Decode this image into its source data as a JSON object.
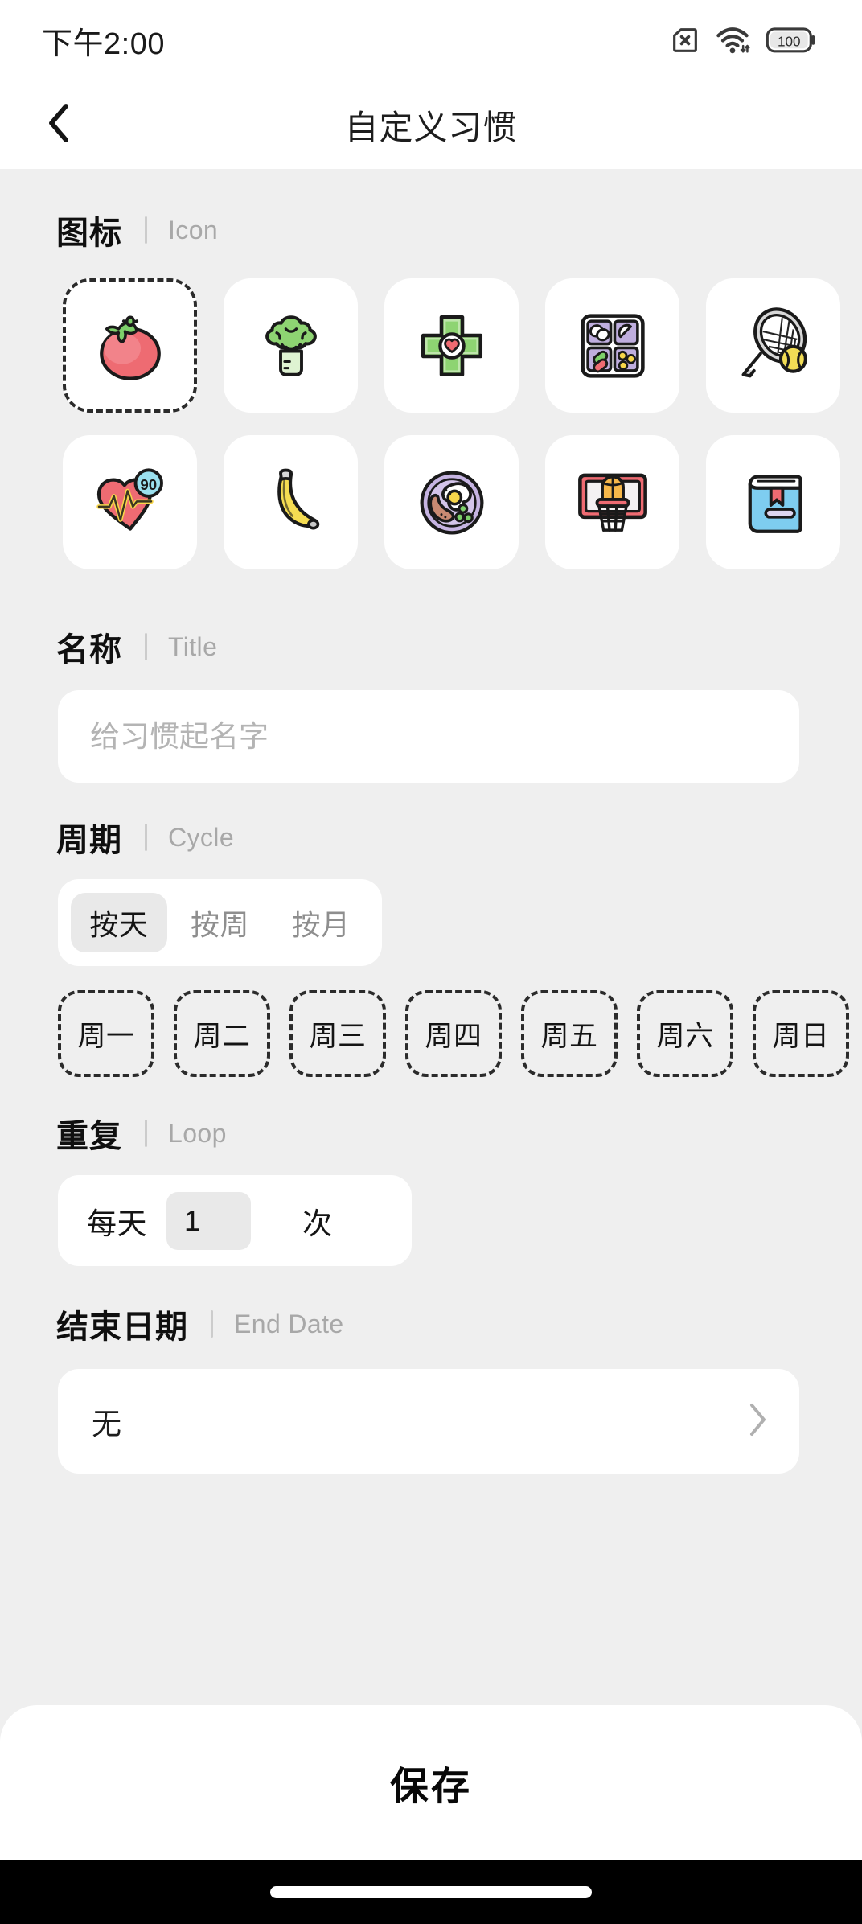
{
  "status_bar": {
    "time": "下午2:00",
    "sim_icon": "sim-card-disabled-icon",
    "wifi_icon": "wifi-icon",
    "battery_icon": "battery-icon",
    "battery_level": "100"
  },
  "nav": {
    "back_icon": "chevron-left-icon",
    "title": "自定义习惯"
  },
  "colors": {
    "page_bg": "#efefef",
    "card_bg": "#ffffff",
    "text_primary": "#141414",
    "text_muted": "#a8a8a8",
    "selected_chip_bg": "#e9e9e9",
    "dashed_border": "#2b2b2b"
  },
  "sections": {
    "icon": {
      "label_cn": "图标",
      "label_en": "Icon",
      "selected_index": 0,
      "rows": [
        [
          {
            "name": "tomato-icon",
            "label": "番茄"
          },
          {
            "name": "broccoli-icon",
            "label": "西兰花"
          },
          {
            "name": "medical-cross-heart-icon",
            "label": "医疗"
          },
          {
            "name": "pill-box-icon",
            "label": "药盒"
          },
          {
            "name": "tennis-racket-icon",
            "label": "网球"
          }
        ],
        [
          {
            "name": "heart-rate-icon",
            "label": "心率",
            "badge": "90"
          },
          {
            "name": "banana-icon",
            "label": "香蕉"
          },
          {
            "name": "breakfast-plate-icon",
            "label": "早餐"
          },
          {
            "name": "basketball-hoop-icon",
            "label": "篮球"
          },
          {
            "name": "book-icon",
            "label": "书本"
          }
        ]
      ]
    },
    "title": {
      "label_cn": "名称",
      "label_en": "Title",
      "input_value": "",
      "input_placeholder": "给习惯起名字"
    },
    "cycle": {
      "label_cn": "周期",
      "label_en": "Cycle",
      "tabs": [
        {
          "label": "按天",
          "active": true
        },
        {
          "label": "按周",
          "active": false
        },
        {
          "label": "按月",
          "active": false
        }
      ],
      "weekdays": [
        {
          "label": "周一",
          "selected": false
        },
        {
          "label": "周二",
          "selected": false
        },
        {
          "label": "周三",
          "selected": false
        },
        {
          "label": "周四",
          "selected": false
        },
        {
          "label": "周五",
          "selected": false
        },
        {
          "label": "周六",
          "selected": false
        },
        {
          "label": "周日",
          "selected": false
        }
      ]
    },
    "loop": {
      "label_cn": "重复",
      "label_en": "Loop",
      "prefix": "每天",
      "count": "1",
      "suffix": "次"
    },
    "end_date": {
      "label_cn": "结束日期",
      "label_en": "End Date",
      "value": "无",
      "chevron_icon": "chevron-right-icon"
    }
  },
  "footer": {
    "save_label": "保存"
  }
}
